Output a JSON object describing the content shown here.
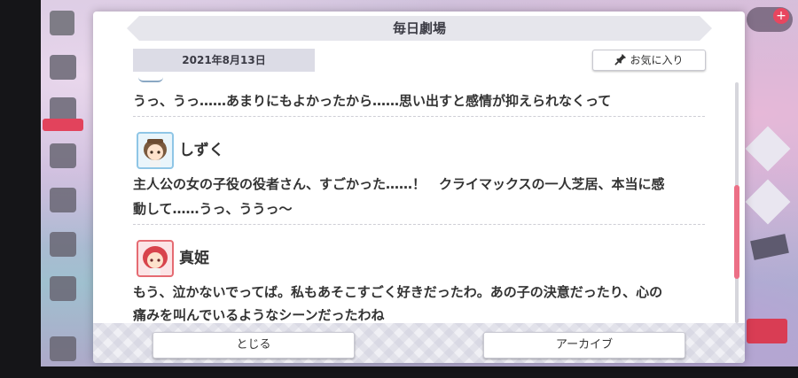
{
  "window": {
    "title": "毎日劇場"
  },
  "header": {
    "date": "2021年8月13日",
    "favorite_label": "お気に入り"
  },
  "messages": [
    {
      "speaker": "",
      "lines": [
        "うっ、うっ……あまりにもよかったから……思い出すと感情が抑えられなくって"
      ]
    },
    {
      "speaker": "しずく",
      "avatar": "shizuku-avatar",
      "lines": [
        "主人公の女の子役の役者さん、すごかった……！　クライマックスの一人芝居、本当に感",
        "動して……うっ、ううっ～"
      ]
    },
    {
      "speaker": "真姫",
      "avatar": "maki-avatar",
      "lines": [
        "もう、泣かないでってば。私もあそこすごく好きだったわ。あの子の決意だったり、心の",
        "痛みを叫んでいるようなシーンだったわね"
      ]
    }
  ],
  "footer": {
    "close_label": "とじる",
    "archive_label": "アーカイブ"
  },
  "colors": {
    "accent": "#ec6f86",
    "title_bar": "#e6e6ec",
    "date_tag": "#dcdce6"
  },
  "icons": [
    "pin-icon",
    "hamburger-menu-icon",
    "plus-icon"
  ]
}
